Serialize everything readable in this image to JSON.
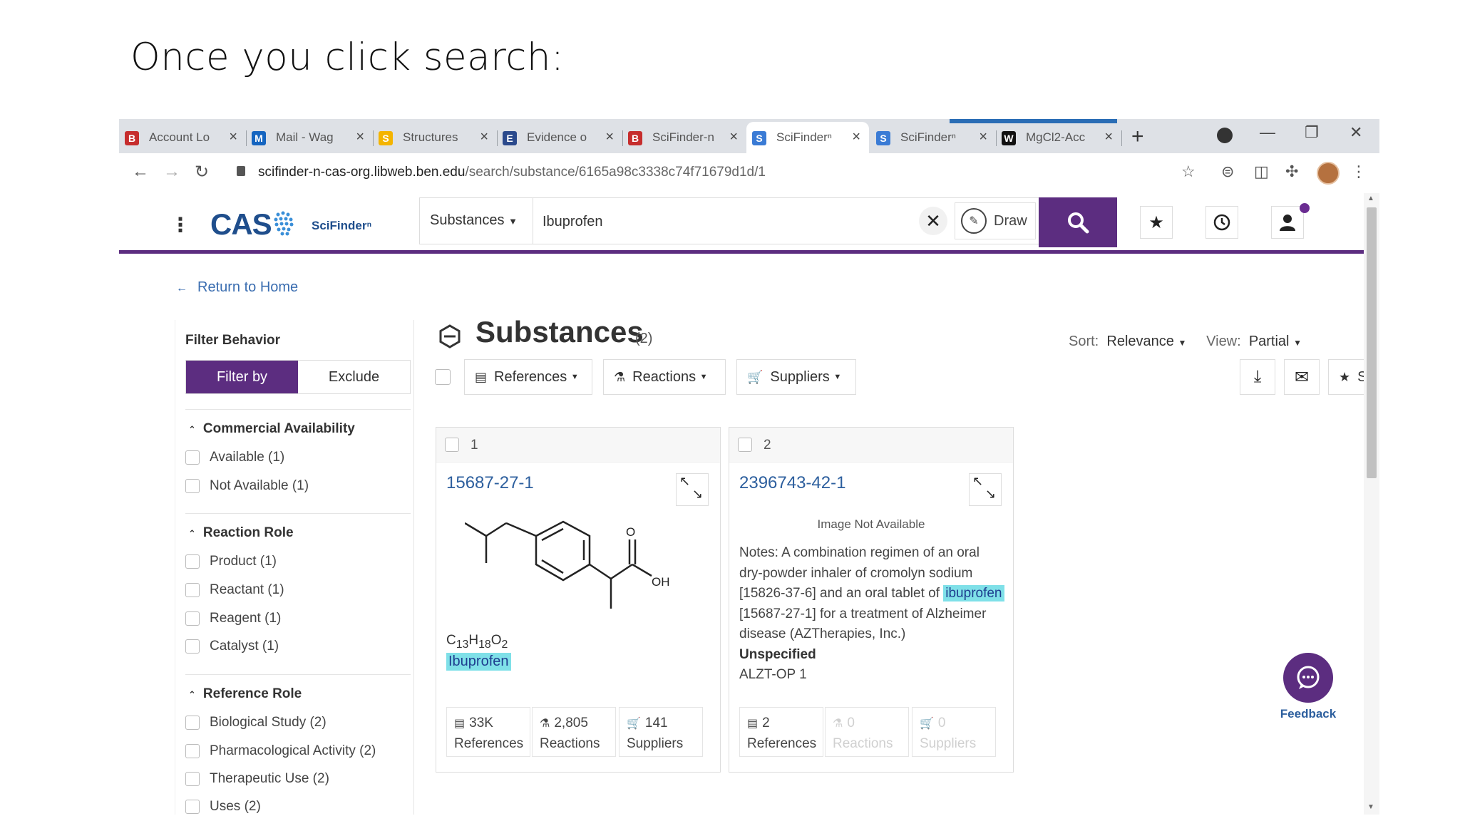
{
  "slide": {
    "title": "Once you click search:"
  },
  "browser": {
    "tabs": [
      {
        "label": "Account Lo",
        "favicon": "B",
        "color": "#c62d2d"
      },
      {
        "label": "Mail - Wag",
        "favicon": "M",
        "color": "#1565c0"
      },
      {
        "label": "Structures",
        "favicon": "S",
        "color": "#f4b400"
      },
      {
        "label": "Evidence o",
        "favicon": "E",
        "color": "#2b4a8c"
      },
      {
        "label": "SciFinder-n",
        "favicon": "B",
        "color": "#c62d2d"
      },
      {
        "label": "SciFinderⁿ",
        "favicon": "S",
        "color": "#3a7bd5"
      },
      {
        "label": "SciFinderⁿ",
        "favicon": "S",
        "color": "#3a7bd5"
      },
      {
        "label": "MgCl2-Acc",
        "favicon": "W",
        "color": "#111111"
      }
    ],
    "url_host": "scifinder-n-cas-org.libweb.ben.edu",
    "url_path": "/search/substance/6165a98c3338c74f71679d1d/1"
  },
  "header": {
    "logo": "CAS",
    "product": "SciFinderⁿ",
    "search_type": "Substances",
    "search_query": "Ibuprofen",
    "draw_label": "Draw"
  },
  "content": {
    "return_label": "Return to Home",
    "title": "Substances",
    "count": "(2)",
    "sort_label": "Sort:",
    "sort_value": "Relevance",
    "view_label": "View:",
    "view_value": "Partial",
    "toolbar": {
      "references": "References",
      "reactions": "Reactions",
      "suppliers": "Suppliers",
      "save": "Save"
    }
  },
  "sidebar": {
    "title": "Filter Behavior",
    "filter_by": "Filter by",
    "exclude": "Exclude",
    "sections": [
      {
        "title": "Commercial Availability",
        "items": [
          "Available (1)",
          "Not Available (1)"
        ]
      },
      {
        "title": "Reaction Role",
        "items": [
          "Product (1)",
          "Reactant (1)",
          "Reagent (1)",
          "Catalyst (1)"
        ]
      },
      {
        "title": "Reference Role",
        "items": [
          "Biological Study (2)",
          "Pharmacological Activity (2)",
          "Therapeutic Use (2)",
          "Uses (2)"
        ]
      }
    ]
  },
  "results": [
    {
      "num": "1",
      "cas_rn": "15687-27-1",
      "formula_parts": [
        "C",
        "13",
        "H",
        "18",
        "O",
        "2"
      ],
      "name": "Ibuprofen",
      "structure_labels": {
        "o": "O",
        "oh": "OH"
      },
      "refs_count": "33K",
      "refs_label": "References",
      "reactions_count": "2,805",
      "reactions_label": "Reactions",
      "suppliers_count": "141",
      "suppliers_label": "Suppliers"
    },
    {
      "num": "2",
      "cas_rn": "2396743-42-1",
      "image_note": "Image Not Available",
      "notes_pre": "Notes: A combination regimen of an oral dry-powder inhaler of cromolyn sodium [15826-37-6] and an oral tablet of",
      "notes_highlight": "ibuprofen",
      "notes_post": "[15687-27-1] for a treatment of Alzheimer disease (AZTherapies, Inc.)",
      "status": "Unspecified",
      "code": "ALZT-OP 1",
      "refs_count": "2",
      "refs_label": "References",
      "reactions_count": "0",
      "reactions_label": "Reactions",
      "suppliers_count": "0",
      "suppliers_label": "Suppliers"
    }
  ],
  "feedback": {
    "label": "Feedback"
  },
  "colors": {
    "brand": "#5c2d80",
    "link": "#2d5f9e",
    "highlight": "#7fe0e8"
  }
}
